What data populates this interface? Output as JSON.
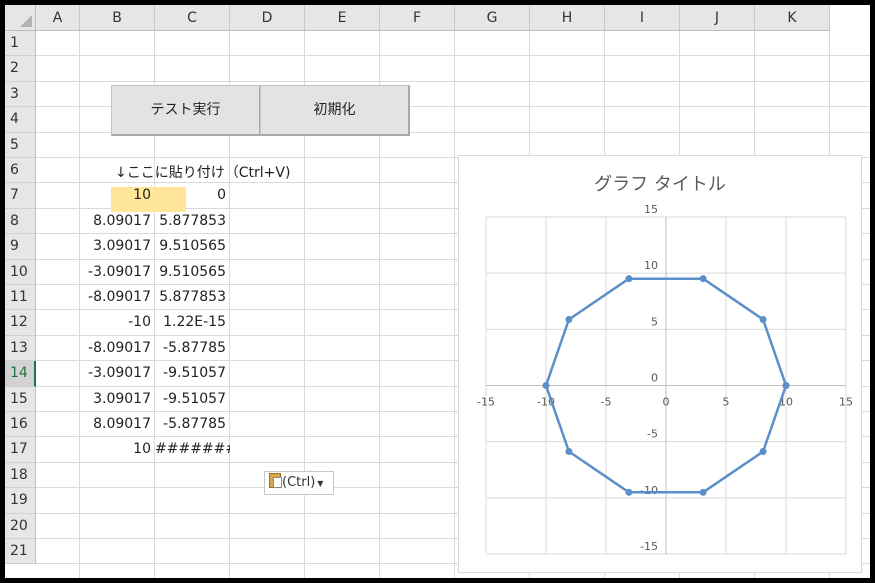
{
  "spreadsheet": {
    "columns": [
      "A",
      "B",
      "C",
      "D",
      "E",
      "F",
      "G",
      "H",
      "I",
      "J",
      "K"
    ],
    "rows": [
      "1",
      "2",
      "3",
      "4",
      "5",
      "6",
      "7",
      "8",
      "9",
      "10",
      "11",
      "12",
      "13",
      "14",
      "15",
      "16",
      "17",
      "18",
      "19",
      "20",
      "21"
    ],
    "selected_row": "14"
  },
  "buttons": {
    "run_test": "テスト実行",
    "reset": "初期化"
  },
  "instruction_text": "↓ここに貼り付け（Ctrl+V)",
  "data_rows": [
    {
      "b": "10",
      "c": "0"
    },
    {
      "b": "8.09017",
      "c": "5.877853"
    },
    {
      "b": "3.09017",
      "c": "9.510565"
    },
    {
      "b": "-3.09017",
      "c": "9.510565"
    },
    {
      "b": "-8.09017",
      "c": "5.877853"
    },
    {
      "b": "-10",
      "c": "1.22E-15"
    },
    {
      "b": "-8.09017",
      "c": "-5.87785"
    },
    {
      "b": "-3.09017",
      "c": "-9.51057"
    },
    {
      "b": "3.09017",
      "c": "-9.51057"
    },
    {
      "b": "8.09017",
      "c": "-5.87785"
    },
    {
      "b": "10",
      "c": "########"
    }
  ],
  "paste_options": {
    "label": "(Ctrl)",
    "icon": "clipboard-icon"
  },
  "colors": {
    "series": "#5b8fc9",
    "selected_cell": "#ffe699",
    "excel_green": "#217346"
  },
  "chart_data": {
    "type": "scatter",
    "title": "グラフ タイトル",
    "xlim": [
      -15,
      15
    ],
    "ylim": [
      -15,
      15
    ],
    "x_ticks": [
      -15,
      -10,
      -5,
      0,
      5,
      10,
      15
    ],
    "y_ticks": [
      -15,
      -10,
      -5,
      0,
      5,
      10,
      15
    ],
    "grid": true,
    "series": [
      {
        "x": [
          10,
          8.09017,
          3.09017,
          -3.09017,
          -8.09017,
          -10,
          -8.09017,
          -3.09017,
          3.09017,
          8.09017,
          10
        ],
        "y": [
          0,
          5.877853,
          9.510565,
          9.510565,
          5.877853,
          0,
          -5.87785,
          -9.51057,
          -9.51057,
          -5.87785,
          0
        ]
      }
    ]
  }
}
